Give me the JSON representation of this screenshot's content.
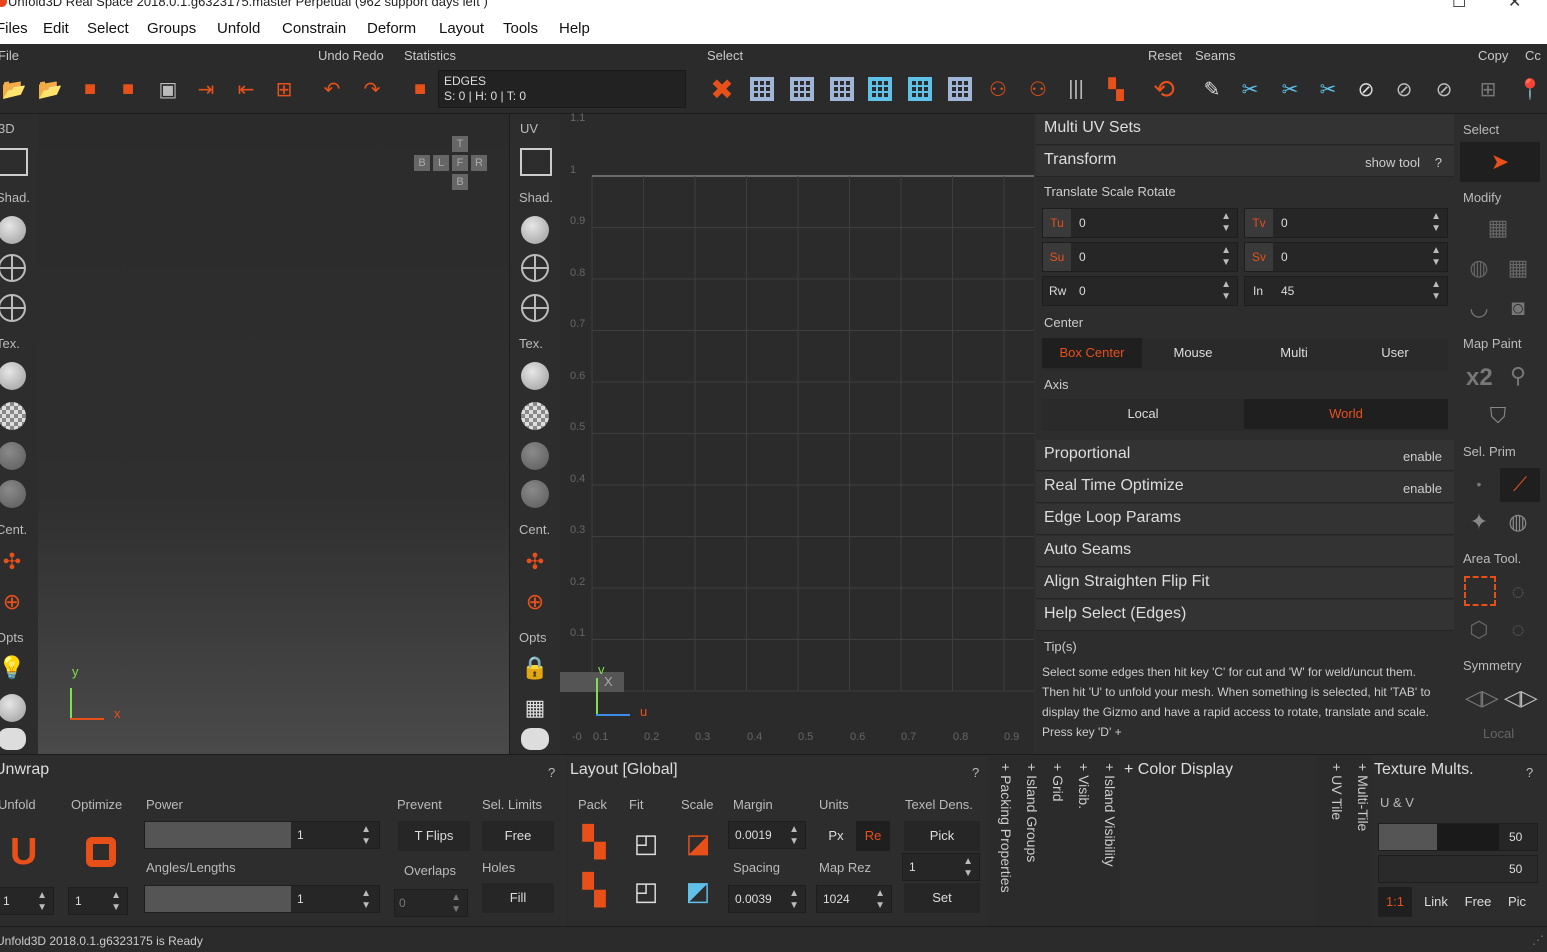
{
  "window": {
    "title": "Unfold3D Real Space 2018.0.1.g6323175.master Perpetual (962 support days left )"
  },
  "menu": [
    "Files",
    "Edit",
    "Select",
    "Groups",
    "Unfold",
    "Constrain",
    "Deform",
    "Layout",
    "Tools",
    "Help"
  ],
  "toolbar": {
    "file": "File",
    "undo_redo": "Undo Redo",
    "statistics": "Statistics",
    "select": "Select",
    "reset": "Reset",
    "seams": "Seams",
    "copy": "Copy",
    "cc": "Cc",
    "edges_mode": "EDGES",
    "edges_stats": "S: 0 | H: 0 | T: 0"
  },
  "left_sidebar": {
    "mode": "3D",
    "shad": "Shad.",
    "tex": "Tex.",
    "cent": "Cent.",
    "opts": "Opts"
  },
  "view3d": {
    "nav": {
      "t": "T",
      "b_top": "B",
      "l": "L",
      "f": "F",
      "r": "R",
      "b": "B"
    },
    "axis_x": "x",
    "axis_y": "y"
  },
  "uv_sidebar": {
    "mode": "UV",
    "shad": "Shad.",
    "tex": "Tex.",
    "cent": "Cent.",
    "opts": "Opts"
  },
  "uvview": {
    "ticks_y": [
      "1.1",
      "1",
      "0.9",
      "0.8",
      "0.7",
      "0.6",
      "0.5",
      "0.4",
      "0.3",
      "0.2",
      "0.1"
    ],
    "ticks_x": [
      "-0",
      "0.1",
      "0.2",
      "0.3",
      "0.4",
      "0.5",
      "0.6",
      "0.7",
      "0.8",
      "0.9"
    ],
    "axis_u": "u",
    "axis_v": "v",
    "close_x": "X"
  },
  "panel": {
    "multi_uv": "Multi UV Sets",
    "transform": "Transform",
    "show_tool": "show tool",
    "help_q": "?",
    "trs_label": "Translate Scale Rotate",
    "tu": {
      "label": "Tu",
      "value": "0"
    },
    "tv": {
      "label": "Tv",
      "value": "0"
    },
    "su": {
      "label": "Su",
      "value": "0"
    },
    "sv": {
      "label": "Sv",
      "value": "0"
    },
    "rw": {
      "label": "Rw",
      "value": "0"
    },
    "in": {
      "label": "In",
      "value": "45"
    },
    "center": "Center",
    "center_opts": [
      "Box Center",
      "Mouse",
      "Multi",
      "User"
    ],
    "axis": "Axis",
    "axis_opts": [
      "Local",
      "World"
    ],
    "proportional": "Proportional",
    "enable": "enable",
    "rto": "Real Time Optimize",
    "edge_loop": "Edge Loop Params",
    "auto_seams": "Auto Seams",
    "align": "Align Straighten Flip Fit",
    "help_select": "Help Select (Edges)",
    "tips": "Tip(s)",
    "tip_text": "Select some edges then hit key 'C' for cut and 'W' for weld/uncut them. Then hit 'U' to unfold your mesh. When something is selected, hit 'TAB' to display the Gizmo and have a rapid access to rotate, translate and scale. Press key 'D' +"
  },
  "rtools": {
    "select": "Select",
    "modify": "Modify",
    "map_paint": "Map Paint",
    "x2": "x2",
    "sel_prim": "Sel. Prim",
    "area_tool": "Area Tool.",
    "symmetry": "Symmetry",
    "local": "Local"
  },
  "unwrap": {
    "title": "Unwrap",
    "q": "?",
    "unfold": "Unfold",
    "optimize": "Optimize",
    "power": "Power",
    "power_val": "1",
    "prevent": "Prevent",
    "sel_limits": "Sel. Limits",
    "tflips": "T Flips",
    "free": "Free",
    "angles": "Angles/Lengths",
    "angles_val": "1",
    "overlaps": "Overlaps",
    "holes": "Holes",
    "fill": "Fill",
    "unfold_val": "1",
    "opt_val": "1",
    "overlaps_val": "0"
  },
  "layout": {
    "title": "Layout [Global]",
    "q": "?",
    "pack": "Pack",
    "fit": "Fit",
    "scale": "Scale",
    "margin": "Margin",
    "margin_val": "0.0019",
    "units": "Units",
    "px": "Px",
    "re": "Re",
    "texel": "Texel Dens.",
    "pick": "Pick",
    "spacing": "Spacing",
    "spacing_val": "0.0039",
    "map_rez": "Map Rez",
    "map_rez_val": "1024",
    "texel_val": "1",
    "set": "Set"
  },
  "vtabs": [
    "Packing Properties",
    "Island Groups",
    "Grid",
    "Visib.",
    "Island Visibility"
  ],
  "color_display": "Color Display",
  "vtabs2": [
    "UV Tile",
    "Multi-Tile"
  ],
  "texmult": {
    "title": "Texture Mults.",
    "q": "?",
    "uv": "U & V",
    "v1": "50",
    "v2": "50",
    "ratio": "1:1",
    "link": "Link",
    "free": "Free",
    "pic": "Pic"
  },
  "status": "Unfold3D 2018.0.1.g6323175 is Ready",
  "colors": {
    "accent": "#e8501a",
    "bg": "#2f2f2f"
  }
}
